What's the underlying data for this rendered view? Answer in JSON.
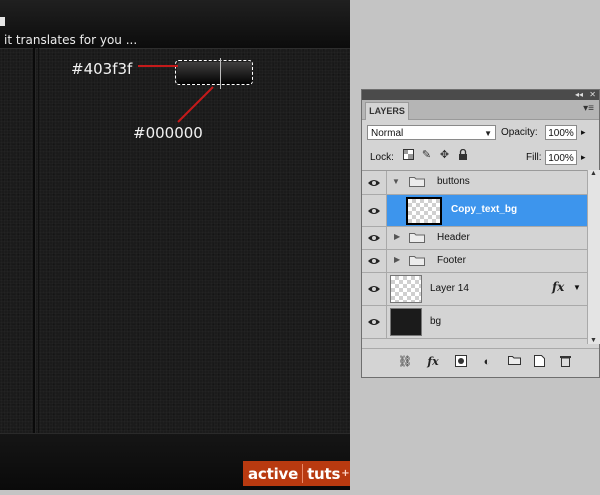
{
  "canvas": {
    "tagline": "it translates for you ...",
    "annotation_top": "#403f3f",
    "annotation_bottom": "#000000",
    "logo_left": "active",
    "logo_right": "tuts",
    "logo_plus": "+"
  },
  "panel": {
    "tab": "LAYERS",
    "blend_mode": "Normal",
    "opacity_label": "Opacity:",
    "opacity_value": "100%",
    "lock_label": "Lock:",
    "fill_label": "Fill:",
    "fill_value": "100%",
    "layers": [
      {
        "name": "buttons",
        "type": "group",
        "expanded": true
      },
      {
        "name": "Copy_text_bg",
        "type": "layer",
        "selected": true
      },
      {
        "name": "Header",
        "type": "group",
        "expanded": false
      },
      {
        "name": "Footer",
        "type": "group",
        "expanded": false
      },
      {
        "name": "Layer 14",
        "type": "layer",
        "has_fx": true
      },
      {
        "name": "bg",
        "type": "layer"
      }
    ]
  },
  "colors": {
    "selection": "#3d95ed",
    "annotation_line": "#c41a1a",
    "logo_bg": "#b83a10",
    "button_top": "#403f3f",
    "button_bottom": "#000000"
  },
  "icons": {
    "lock_row": [
      "lock-transparent-icon",
      "lock-paint-icon",
      "lock-move-icon",
      "lock-all-icon"
    ],
    "bottom_bar": [
      "link-layers-icon",
      "fx-icon",
      "mask-icon",
      "adjustment-icon",
      "new-group-icon",
      "new-layer-icon",
      "trash-icon"
    ]
  }
}
